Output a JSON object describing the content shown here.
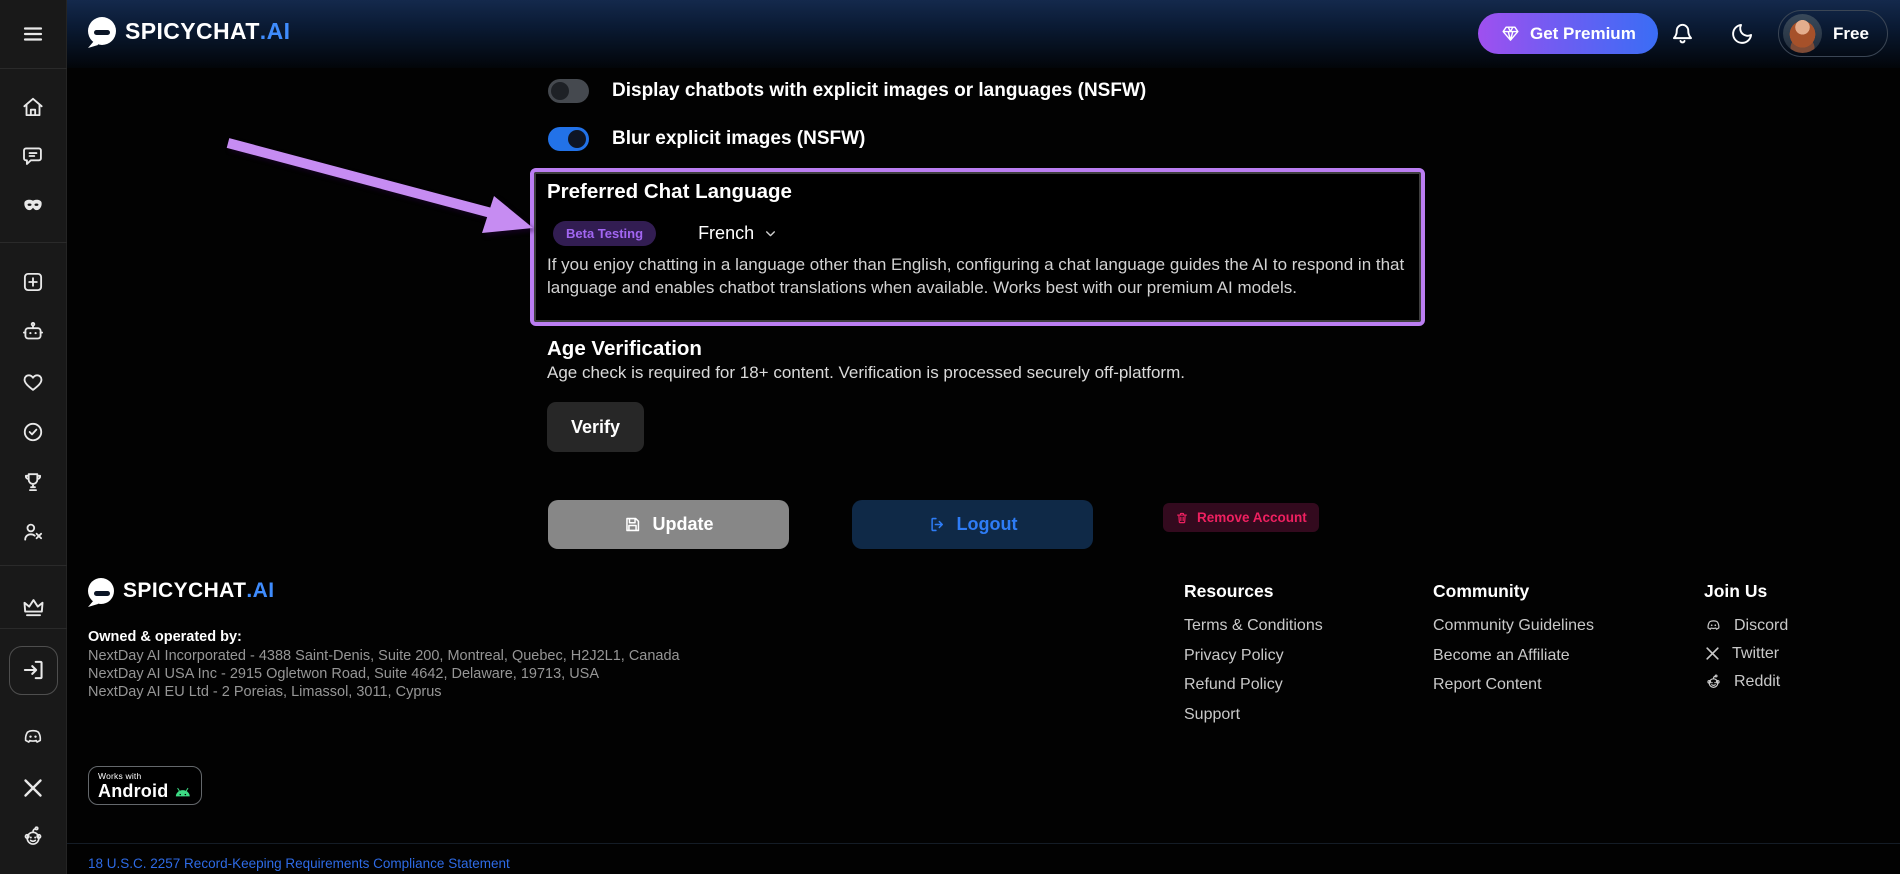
{
  "navbar": {
    "logo_primary": "SPICYCHAT",
    "logo_suffix": ".AI",
    "get_premium_label": "Get Premium",
    "plan_label": "Free",
    "icons": [
      "menu-icon",
      "diamond-icon",
      "bell-icon",
      "moon-icon",
      "avatar"
    ]
  },
  "sidebar": {
    "icons": [
      "home",
      "chats",
      "personas",
      "create-chatbot",
      "my-chatbots",
      "favorites",
      "verified",
      "trophy",
      "unfollowed",
      "premium-crown",
      "login",
      "discord",
      "x-twitter",
      "reddit"
    ],
    "active_item": "login"
  },
  "settings": {
    "toggles": [
      {
        "label": "Display chatbots with explicit images or languages (NSFW)",
        "state": "off"
      },
      {
        "label": "Blur explicit images (NSFW)",
        "state": "on"
      }
    ],
    "language": {
      "title": "Preferred Chat Language",
      "badge": "Beta Testing",
      "selected": "French",
      "description": "If you enjoy chatting in a language other than English, configuring a chat language guides the AI to respond in that language and enables chatbot translations when available. Works best with our premium AI models."
    },
    "age_verification": {
      "title": "Age Verification",
      "description": "Age check is required for 18+ content. Verification is processed securely off-platform.",
      "verify_label": "Verify"
    },
    "actions": {
      "update": "Update",
      "logout": "Logout",
      "remove": "Remove Account"
    }
  },
  "footer": {
    "logo_primary": "SPICYCHAT",
    "logo_suffix": ".AI",
    "owned_title": "Owned & operated by:",
    "owned_lines": [
      "NextDay AI Incorporated - 4388 Saint-Denis, Suite 200, Montreal, Quebec, H2J2L1, Canada",
      "NextDay AI USA Inc - 2915 Ogletwon Road, Suite 4642, Delaware, 19713, USA",
      "NextDay AI EU Ltd - 2 Poreias, Limassol, 3011, Cyprus"
    ],
    "columns": [
      {
        "title": "Resources",
        "links": [
          "Terms & Conditions",
          "Privacy Policy",
          "Refund Policy",
          "Support"
        ]
      },
      {
        "title": "Community",
        "links": [
          "Community Guidelines",
          "Become an Affiliate",
          "Report Content"
        ]
      },
      {
        "title": "Join Us",
        "links": [
          "Discord",
          "Twitter",
          "Reddit"
        ]
      }
    ],
    "android_badge": {
      "line1": "Works with",
      "line2": "Android"
    },
    "compliance_link": "18 U.S.C. 2257 Record-Keeping Requirements Compliance Statement"
  },
  "colors": {
    "accent_purple": "#a855f7",
    "accent_blue": "#3b82f6",
    "toggle_on": "#2272e8",
    "highlight_border": "#bb7ef2",
    "danger_text": "#ee2060",
    "logout_text": "#2e7cf6",
    "android_green": "#3ddc84"
  }
}
